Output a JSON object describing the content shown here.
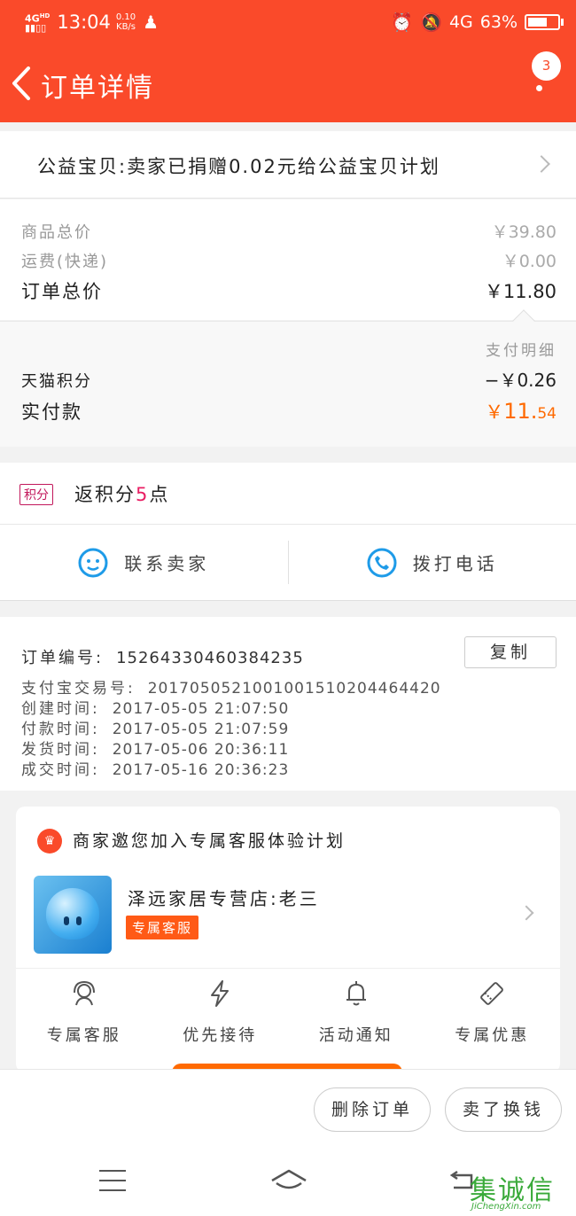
{
  "status_bar": {
    "network": "4G",
    "network_sup": "HD",
    "time": "13:04",
    "speed_value": "0.10",
    "speed_unit": "KB/s",
    "data_type": "4G",
    "battery": "63%"
  },
  "header": {
    "title": "订单详情",
    "badge_count": "3"
  },
  "charity": {
    "text": "公益宝贝:卖家已捐赠0.02元给公益宝贝计划"
  },
  "prices": {
    "goods_total_label": "商品总价",
    "goods_total_value": "￥39.80",
    "shipping_label": "运费(快递)",
    "shipping_value": "￥0.00",
    "order_total_label": "订单总价",
    "order_total_value": "￥11.80"
  },
  "payment": {
    "detail_label": "支付明细",
    "points_label": "天猫积分",
    "points_value": "−￥0.26",
    "paid_label": "实付款",
    "paid_currency": "￥",
    "paid_int": "11.",
    "paid_dec": "54"
  },
  "rewards": {
    "tag": "积分",
    "prefix": "返积分",
    "number": "5",
    "suffix": "点"
  },
  "contact": {
    "seller": "联系卖家",
    "phone": "拨打电话"
  },
  "order": {
    "number_label": "订单编号:",
    "number_value": "15264330460384235",
    "copy": "复制",
    "alipay_label": "支付宝交易号:",
    "alipay_value": "2017050521001001510204464420",
    "created_label": "创建时间:",
    "created_value": "2017-05-05 21:07:50",
    "paid_label": "付款时间:",
    "paid_value": "2017-05-05 21:07:59",
    "shipped_label": "发货时间:",
    "shipped_value": "2017-05-06 20:36:11",
    "completed_label": "成交时间:",
    "completed_value": "2017-05-16 20:36:23"
  },
  "invite": {
    "title": "商家邀您加入专属客服体验计划",
    "shop": "泽远家居专营店:老三",
    "badge": "专属客服",
    "benefits": [
      {
        "label": "专属客服",
        "icon": "headset-icon"
      },
      {
        "label": "优先接待",
        "icon": "lightning-icon"
      },
      {
        "label": "活动通知",
        "icon": "bell-icon"
      },
      {
        "label": "专属优惠",
        "icon": "coupon-icon"
      }
    ]
  },
  "actions": {
    "delete": "删除订单",
    "resell": "卖了换钱"
  },
  "watermark": {
    "text": "集诚信",
    "site": "JiChengXin.com"
  },
  "colors": {
    "brand": "#fa4a2a",
    "accent_orange": "#ff6a00",
    "points_pink": "#e91e63",
    "icon_blue": "#1e9be8"
  }
}
